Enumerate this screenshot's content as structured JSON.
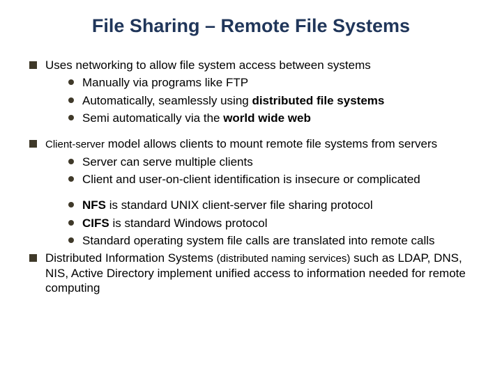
{
  "title": "File Sharing – Remote File Systems",
  "b1": {
    "text": "Uses networking to allow file system access between systems",
    "s1": "Manually via programs like FTP",
    "s2a": "Automatically, seamlessly using ",
    "s2b": "distributed file systems",
    "s3a": "Semi automatically via the ",
    "s3b": "world wide web"
  },
  "b2": {
    "t1": "Client-server",
    "t2": " model allows clients to mount remote file systems from servers",
    "s1": "Server can serve multiple clients",
    "s2": "Client and user-on-client identification is insecure or complicated",
    "s3a": "NFS",
    "s3b": " is standard UNIX client-server file sharing protocol",
    "s4a": "CIFS",
    "s4b": " is standard Windows protocol",
    "s5": "Standard operating system file calls are translated into remote calls"
  },
  "b3": {
    "t1": "Distributed Information Systems ",
    "t2": "(distributed naming services)",
    "t3": " such as LDAP, DNS, NIS, Active Directory implement unified access to information needed for remote computing"
  }
}
